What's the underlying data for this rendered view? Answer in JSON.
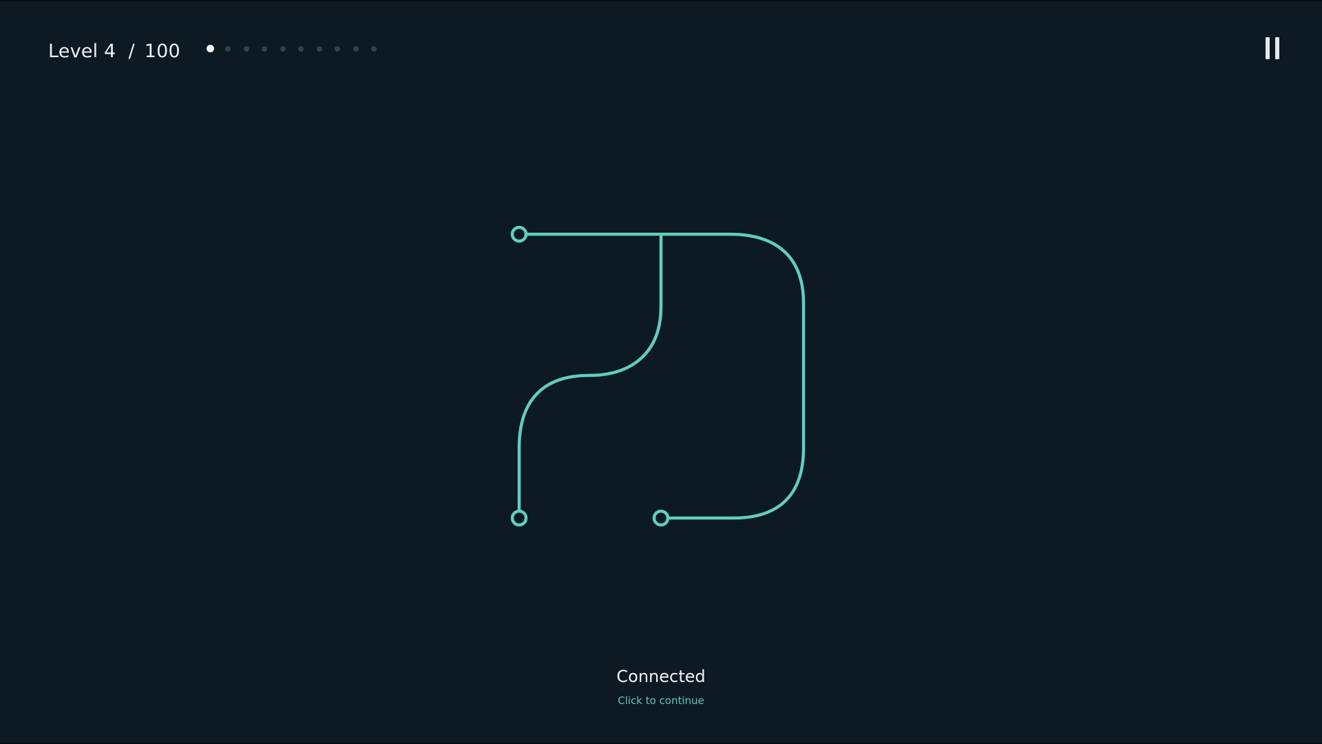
{
  "hud": {
    "level_label": "Level 4",
    "separator": "/",
    "total_levels": "100",
    "progress_dots_total": 10,
    "progress_dots_active": 1
  },
  "pause_icon": "pause-icon",
  "status": {
    "title": "Connected",
    "hint": "Click to continue"
  },
  "colors": {
    "background": "#0d1923",
    "path": "#62cdbf",
    "text": "#eef1f3",
    "dot_active": "#f4f6f7",
    "dot_inactive": "#34414b"
  }
}
